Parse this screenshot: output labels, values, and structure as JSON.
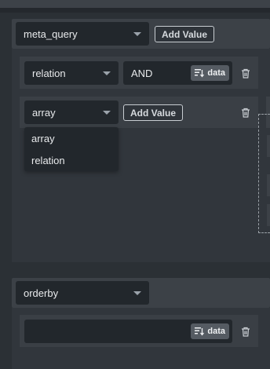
{
  "meta_query": {
    "key_select": "meta_query",
    "add_value_label": "Add Value",
    "relation_row": {
      "key_select": "relation",
      "value": "AND",
      "data_label": "data"
    },
    "array_row": {
      "key_select": "array",
      "add_value_label": "Add Value",
      "dropdown_options": [
        "array",
        "relation"
      ]
    }
  },
  "orderby": {
    "key_select": "orderby",
    "value": "",
    "data_label": "data"
  },
  "icons": {
    "data": "data-list-icon",
    "delete": "trash-icon",
    "chevron": "chevron-down-icon"
  },
  "colors": {
    "background": "#2b3035",
    "field": "#22272c",
    "header": "#3c4147",
    "data_button": "#555b62"
  }
}
